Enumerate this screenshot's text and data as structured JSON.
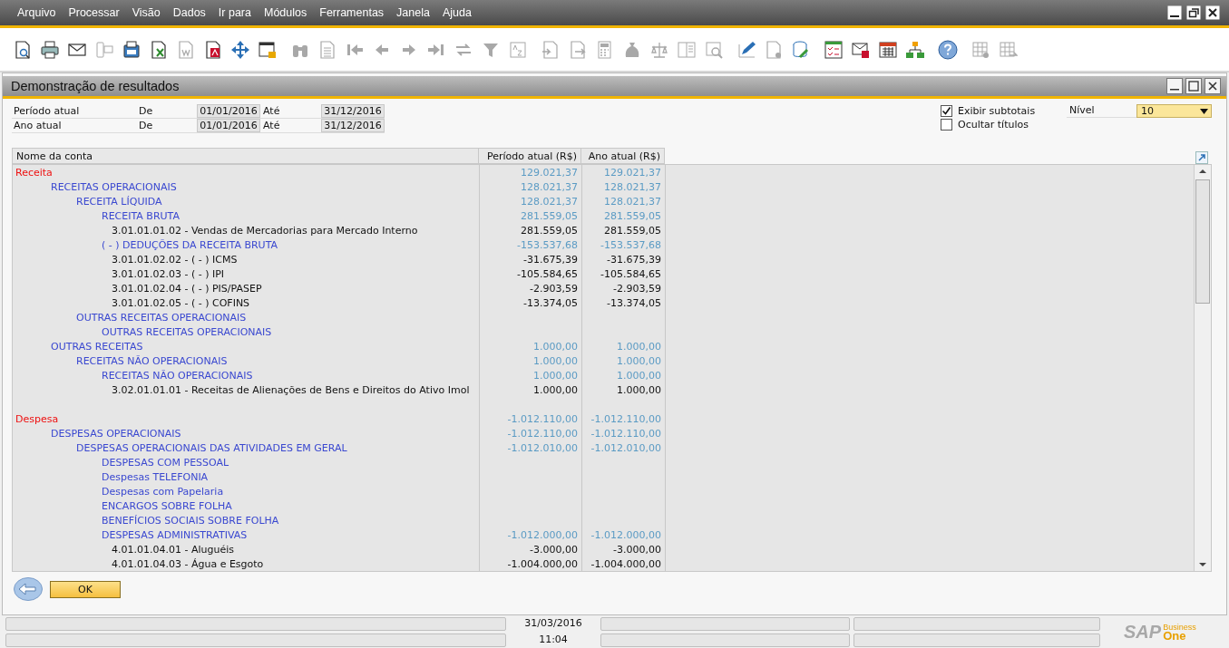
{
  "menu": [
    {
      "label": "Arquivo"
    },
    {
      "label": "Processar"
    },
    {
      "label": "Visão"
    },
    {
      "label": "Dados"
    },
    {
      "label": "Ir para"
    },
    {
      "label": "Módulos"
    },
    {
      "label": "Ferramentas"
    },
    {
      "label": "Janela"
    },
    {
      "label": "Ajuda"
    }
  ],
  "toolbar": [
    [
      {
        "disabled": false
      },
      {
        "disabled": false
      },
      {
        "disabled": false
      },
      {
        "disabled": true
      },
      {
        "disabled": false
      },
      {
        "disabled": false
      },
      {
        "disabled": true
      },
      {
        "disabled": false
      },
      {
        "disabled": false
      },
      {
        "disabled": false
      }
    ],
    [
      {
        "disabled": true
      },
      {
        "disabled": true
      },
      {
        "disabled": true
      },
      {
        "disabled": true
      },
      {
        "disabled": true
      },
      {
        "disabled": true
      },
      {
        "disabled": true
      },
      {
        "disabled": true
      },
      {
        "disabled": true
      }
    ],
    [
      {
        "disabled": true
      },
      {
        "disabled": true
      },
      {
        "disabled": true
      },
      {
        "disabled": true
      },
      {
        "disabled": true
      },
      {
        "disabled": true
      },
      {
        "disabled": true
      }
    ],
    [
      {
        "disabled": false
      },
      {
        "disabled": true
      },
      {
        "disabled": false
      }
    ],
    [
      {
        "disabled": false
      },
      {
        "disabled": false
      },
      {
        "disabled": false
      },
      {
        "disabled": false
      }
    ],
    [
      {
        "disabled": false
      }
    ],
    [
      {
        "disabled": true
      },
      {
        "disabled": true
      }
    ]
  ],
  "window": {
    "title": "Demonstração de resultados"
  },
  "periods": [
    {
      "label": "Período atual",
      "from_label": "De",
      "from": "01/01/2016",
      "to_label": "Até",
      "to": "31/12/2016"
    },
    {
      "label": "Ano atual",
      "from_label": "De",
      "from": "01/01/2016",
      "to_label": "Até",
      "to": "31/12/2016"
    }
  ],
  "options": [
    {
      "label": "Exibir subtotais",
      "checked": true
    },
    {
      "label": "Ocultar títulos",
      "checked": false
    }
  ],
  "level_select": {
    "label": "Nível",
    "value": "10"
  },
  "table": {
    "columns": [
      "Nome da conta",
      "Período atual (R$)",
      "Ano atual (R$)"
    ],
    "rows": [
      {
        "kind": "group",
        "name": "Receita",
        "period": "129.021,37",
        "year": "129.021,37",
        "children": [
          {
            "kind": "title",
            "name": "RECEITAS OPERACIONAIS",
            "period": "128.021,37",
            "year": "128.021,37",
            "children": [
              {
                "kind": "title",
                "name": "RECEITA LÍQUIDA",
                "period": "128.021,37",
                "year": "128.021,37",
                "children": [
                  {
                    "kind": "title",
                    "name": "RECEITA BRUTA",
                    "period": "281.559,05",
                    "year": "281.559,05",
                    "children": [
                      {
                        "kind": "account",
                        "name": "3.01.01.01.02 - Vendas de Mercadorias para Mercado Interno",
                        "period": "281.559,05",
                        "year": "281.559,05"
                      }
                    ]
                  },
                  {
                    "kind": "title",
                    "name": "( - ) DEDUÇÕES DA RECEITA BRUTA",
                    "period": "-153.537,68",
                    "year": "-153.537,68",
                    "children": [
                      {
                        "kind": "account",
                        "name": "3.01.01.02.02 - ( - ) ICMS",
                        "period": "-31.675,39",
                        "year": "-31.675,39"
                      },
                      {
                        "kind": "account",
                        "name": "3.01.01.02.03 - ( - ) IPI",
                        "period": "-105.584,65",
                        "year": "-105.584,65"
                      },
                      {
                        "kind": "account",
                        "name": "3.01.01.02.04 - ( - ) PIS/PASEP",
                        "period": "-2.903,59",
                        "year": "-2.903,59"
                      },
                      {
                        "kind": "account",
                        "name": "3.01.01.02.05 - ( - ) COFINS",
                        "period": "-13.374,05",
                        "year": "-13.374,05"
                      }
                    ]
                  }
                ]
              },
              {
                "kind": "title",
                "name": "OUTRAS RECEITAS OPERACIONAIS",
                "children": [
                  {
                    "kind": "title",
                    "name": "OUTRAS RECEITAS OPERACIONAIS"
                  }
                ]
              }
            ]
          },
          {
            "kind": "title",
            "name": "OUTRAS RECEITAS",
            "period": "1.000,00",
            "year": "1.000,00",
            "children": [
              {
                "kind": "title",
                "name": "RECEITAS NÃO OPERACIONAIS",
                "period": "1.000,00",
                "year": "1.000,00",
                "children": [
                  {
                    "kind": "title",
                    "name": "RECEITAS NÃO OPERACIONAIS",
                    "period": "1.000,00",
                    "year": "1.000,00",
                    "children": [
                      {
                        "kind": "account",
                        "name": "3.02.01.01.01 - Receitas de Alienações de Bens e Direitos do Ativo Imol",
                        "period": "1.000,00",
                        "year": "1.000,00"
                      }
                    ]
                  }
                ]
              }
            ]
          }
        ]
      },
      {
        "kind": "group",
        "name": "Despesa",
        "period": "-1.012.110,00",
        "year": "-1.012.110,00",
        "children": [
          {
            "kind": "title",
            "name": "DESPESAS OPERACIONAIS",
            "period": "-1.012.110,00",
            "year": "-1.012.110,00",
            "children": [
              {
                "kind": "title",
                "name": "DESPESAS OPERACIONAIS DAS ATIVIDADES EM GERAL",
                "period": "-1.012.010,00",
                "year": "-1.012.010,00",
                "children": [
                  {
                    "kind": "title",
                    "name": "DESPESAS COM PESSOAL"
                  },
                  {
                    "kind": "title",
                    "name": "Despesas TELEFONIA"
                  },
                  {
                    "kind": "title",
                    "name": "Despesas com Papelaria"
                  },
                  {
                    "kind": "title",
                    "name": "ENCARGOS SOBRE FOLHA"
                  },
                  {
                    "kind": "title",
                    "name": "BENEFÍCIOS SOCIAIS SOBRE FOLHA"
                  },
                  {
                    "kind": "title",
                    "name": "DESPESAS ADMINISTRATIVAS",
                    "period": "-1.012.000,00",
                    "year": "-1.012.000,00",
                    "children": [
                      {
                        "kind": "account",
                        "name": "4.01.01.04.01 - Aluguéis",
                        "period": "-3.000,00",
                        "year": "-3.000,00"
                      },
                      {
                        "kind": "account",
                        "name": "4.01.01.04.03 - Água e Esgoto",
                        "period": "-1.004.000,00",
                        "year": "-1.004.000,00"
                      }
                    ]
                  }
                ]
              }
            ]
          }
        ]
      }
    ]
  },
  "buttons": [
    {
      "label": "OK"
    }
  ],
  "status_bar": {
    "date": "31/03/2016",
    "time": "11:04"
  },
  "logo": {
    "brand": "SAP",
    "line_1": "Business",
    "line_2": "One"
  }
}
